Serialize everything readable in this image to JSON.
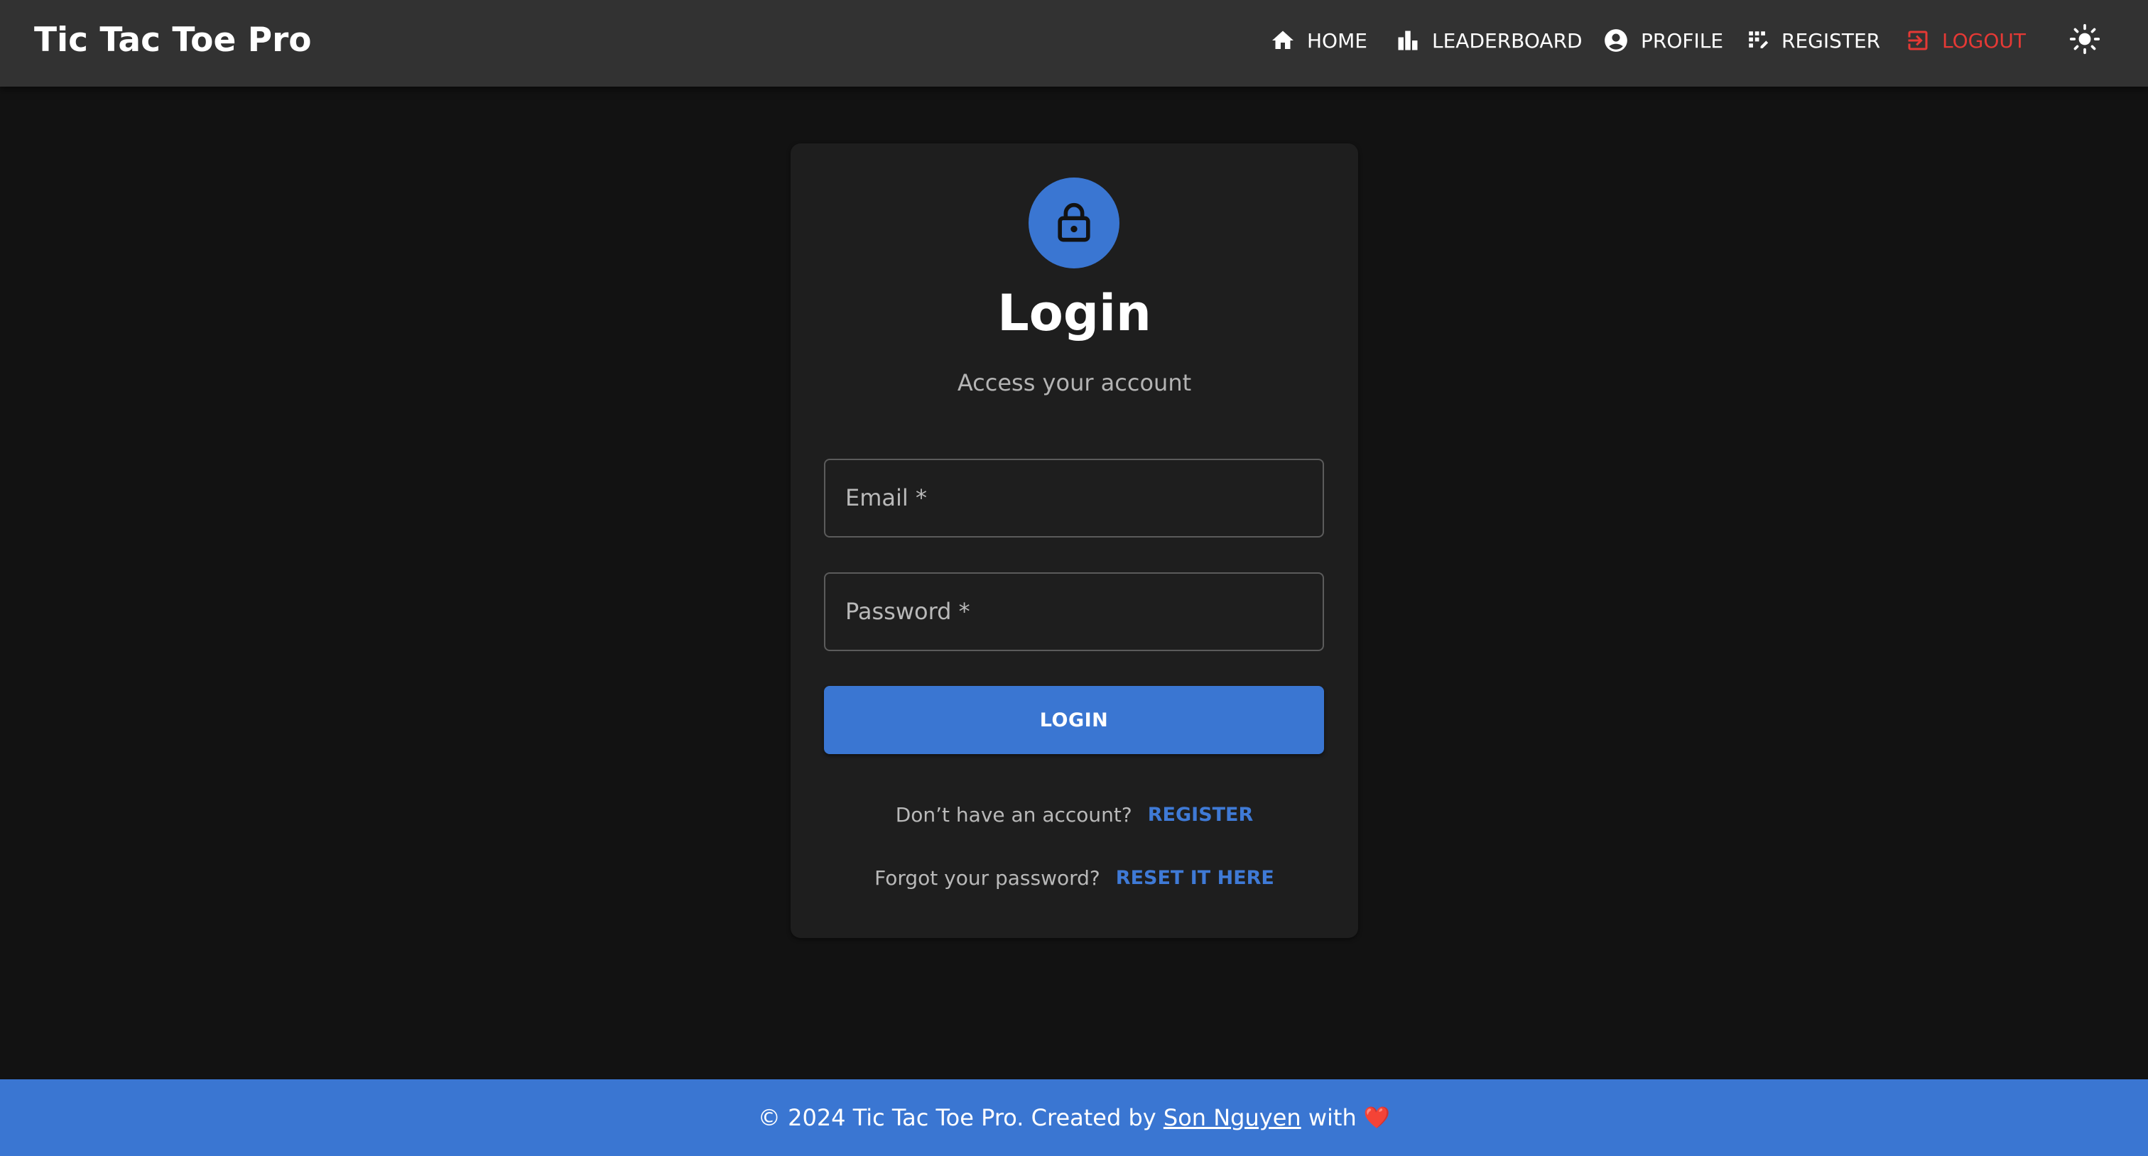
{
  "header": {
    "title": "Tic Tac Toe Pro",
    "nav": {
      "home": "HOME",
      "leaderboard": "LEADERBOARD",
      "profile": "PROFILE",
      "register": "REGISTER",
      "logout": "LOGOUT"
    },
    "icons": {
      "home": "home-icon",
      "leaderboard": "leaderboard-icon",
      "profile": "account-circle-icon",
      "register": "register-icon",
      "logout": "logout-icon",
      "theme": "sun-icon"
    }
  },
  "login": {
    "icon": "lock-icon",
    "title": "Login",
    "subtitle": "Access your account",
    "email_label": "Email *",
    "email_value": "",
    "password_label": "Password *",
    "password_value": "",
    "button_label": "LOGIN",
    "no_account_text": "Don’t have an account?",
    "register_link": "REGISTER",
    "forgot_text": "Forgot your password?",
    "reset_link": "RESET IT HERE"
  },
  "footer": {
    "prefix": "© 2024 Tic Tac Toe Pro. Created by ",
    "author": "Son Nguyen",
    "suffix": " with",
    "heart": "❤️"
  },
  "colors": {
    "appbar": "#323232",
    "background": "#121212",
    "card": "#1e1e1e",
    "primary": "#3a76d2",
    "logout": "#e53935",
    "link": "#3f7ad6"
  }
}
